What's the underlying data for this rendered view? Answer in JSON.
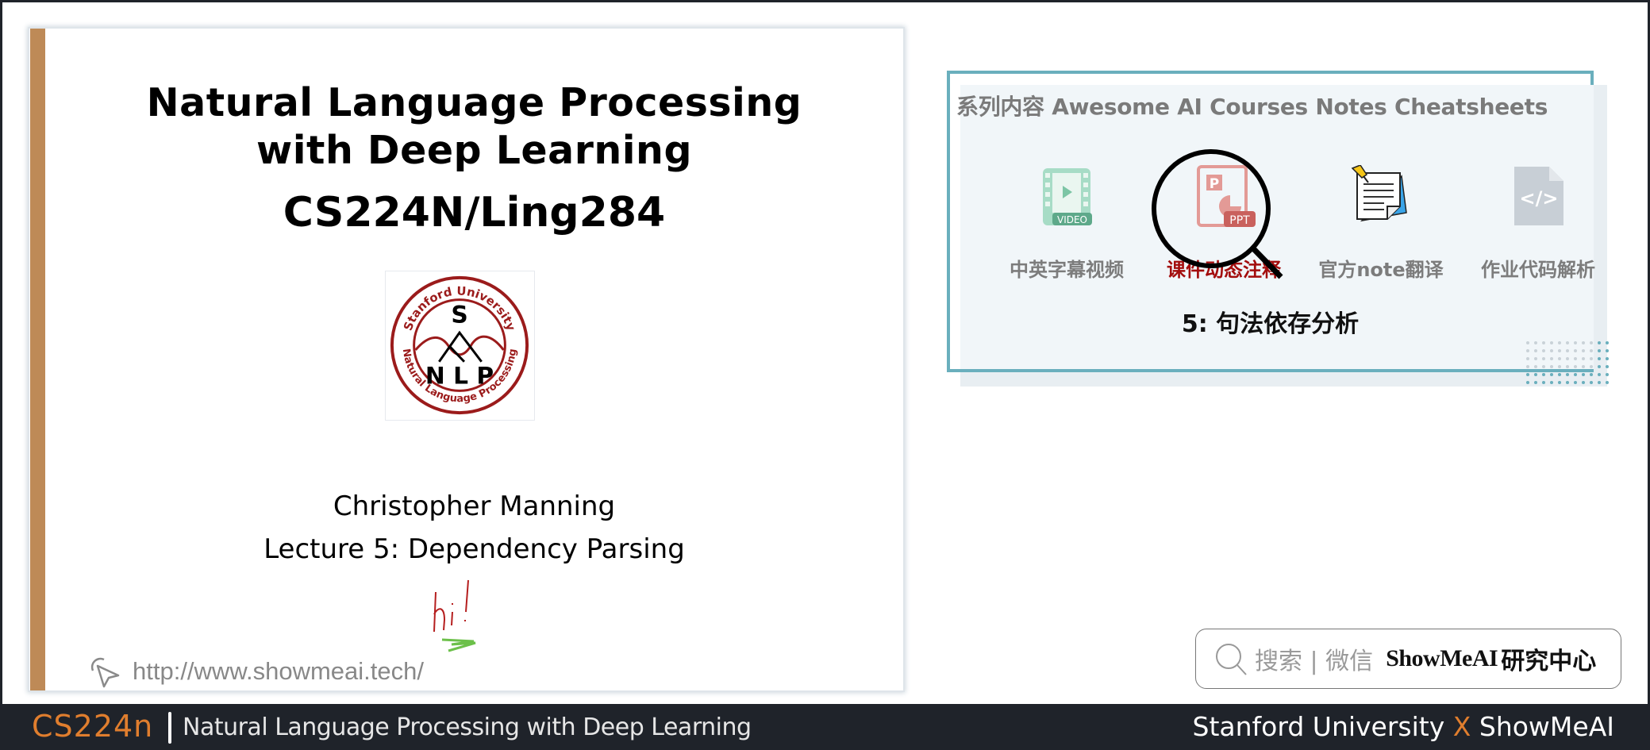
{
  "slide": {
    "title_line1": "Natural Language Processing",
    "title_line2": "with Deep Learning",
    "course_code": "CS224N/Ling284",
    "logo": {
      "icon": "stanford-nlp-logo",
      "ring_top": "Stanford University",
      "ring_bottom": "Natural Language Processing",
      "center_top": "S",
      "center_bottom": "N L P"
    },
    "author": "Christopher Manning",
    "lecture": "Lecture 5: Dependency Parsing",
    "handwriting": "Hi!",
    "url": "http://www.showmeai.tech/",
    "url_icon": "cursor-click-icon"
  },
  "series_card": {
    "title": "系列内容 Awesome AI Courses Notes Cheatsheets",
    "items": [
      {
        "label": "中英字幕视频",
        "icon": "video-icon",
        "badge": "VIDEO",
        "active": false
      },
      {
        "label": "课件动态注释",
        "icon": "ppt-icon",
        "badge": "PPT",
        "active": true
      },
      {
        "label": "官方note翻译",
        "icon": "note-icon",
        "badge": "",
        "active": false
      },
      {
        "label": "作业代码解析",
        "icon": "code-file-icon",
        "badge": "</>",
        "active": false
      }
    ],
    "subtitle": "5: 句法依存分析",
    "colors": {
      "border": "#6aafbd",
      "active_label": "#a30d0d"
    }
  },
  "search_box": {
    "icon": "search-icon",
    "label": "搜索 | 微信",
    "brand": "ShowMeAI",
    "brand_suffix": "研究中心"
  },
  "footer": {
    "course": "CS224n",
    "description": "Natural Language Processing with Deep Learning",
    "partner_left": "Stanford University",
    "partner_x": "X",
    "partner_right": "ShowMeAI",
    "colors": {
      "accent": "#e07e2e",
      "background": "#1f232a"
    }
  }
}
